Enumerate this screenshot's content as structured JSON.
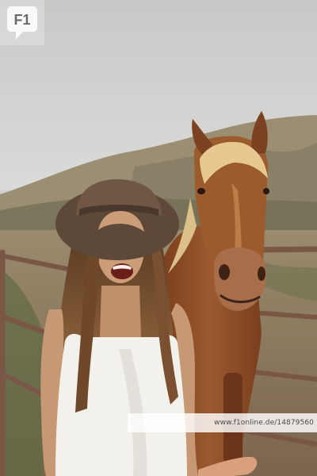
{
  "photo": {
    "subject": "woman-with-horse",
    "colors": {
      "sky": "#d2d3d1",
      "hill": "#9e8f74",
      "ground": "#8a7358",
      "horse": "#8a4a22",
      "mane": "#e6c48e",
      "hat": "#6b5443",
      "hair": "#7a5230",
      "skin": "#c99a76",
      "dress": "#f2f0ec",
      "fence": "#7d5a4a"
    }
  },
  "watermark": {
    "logo_text": "F1",
    "caption": "www.f1online.de/14879560"
  }
}
